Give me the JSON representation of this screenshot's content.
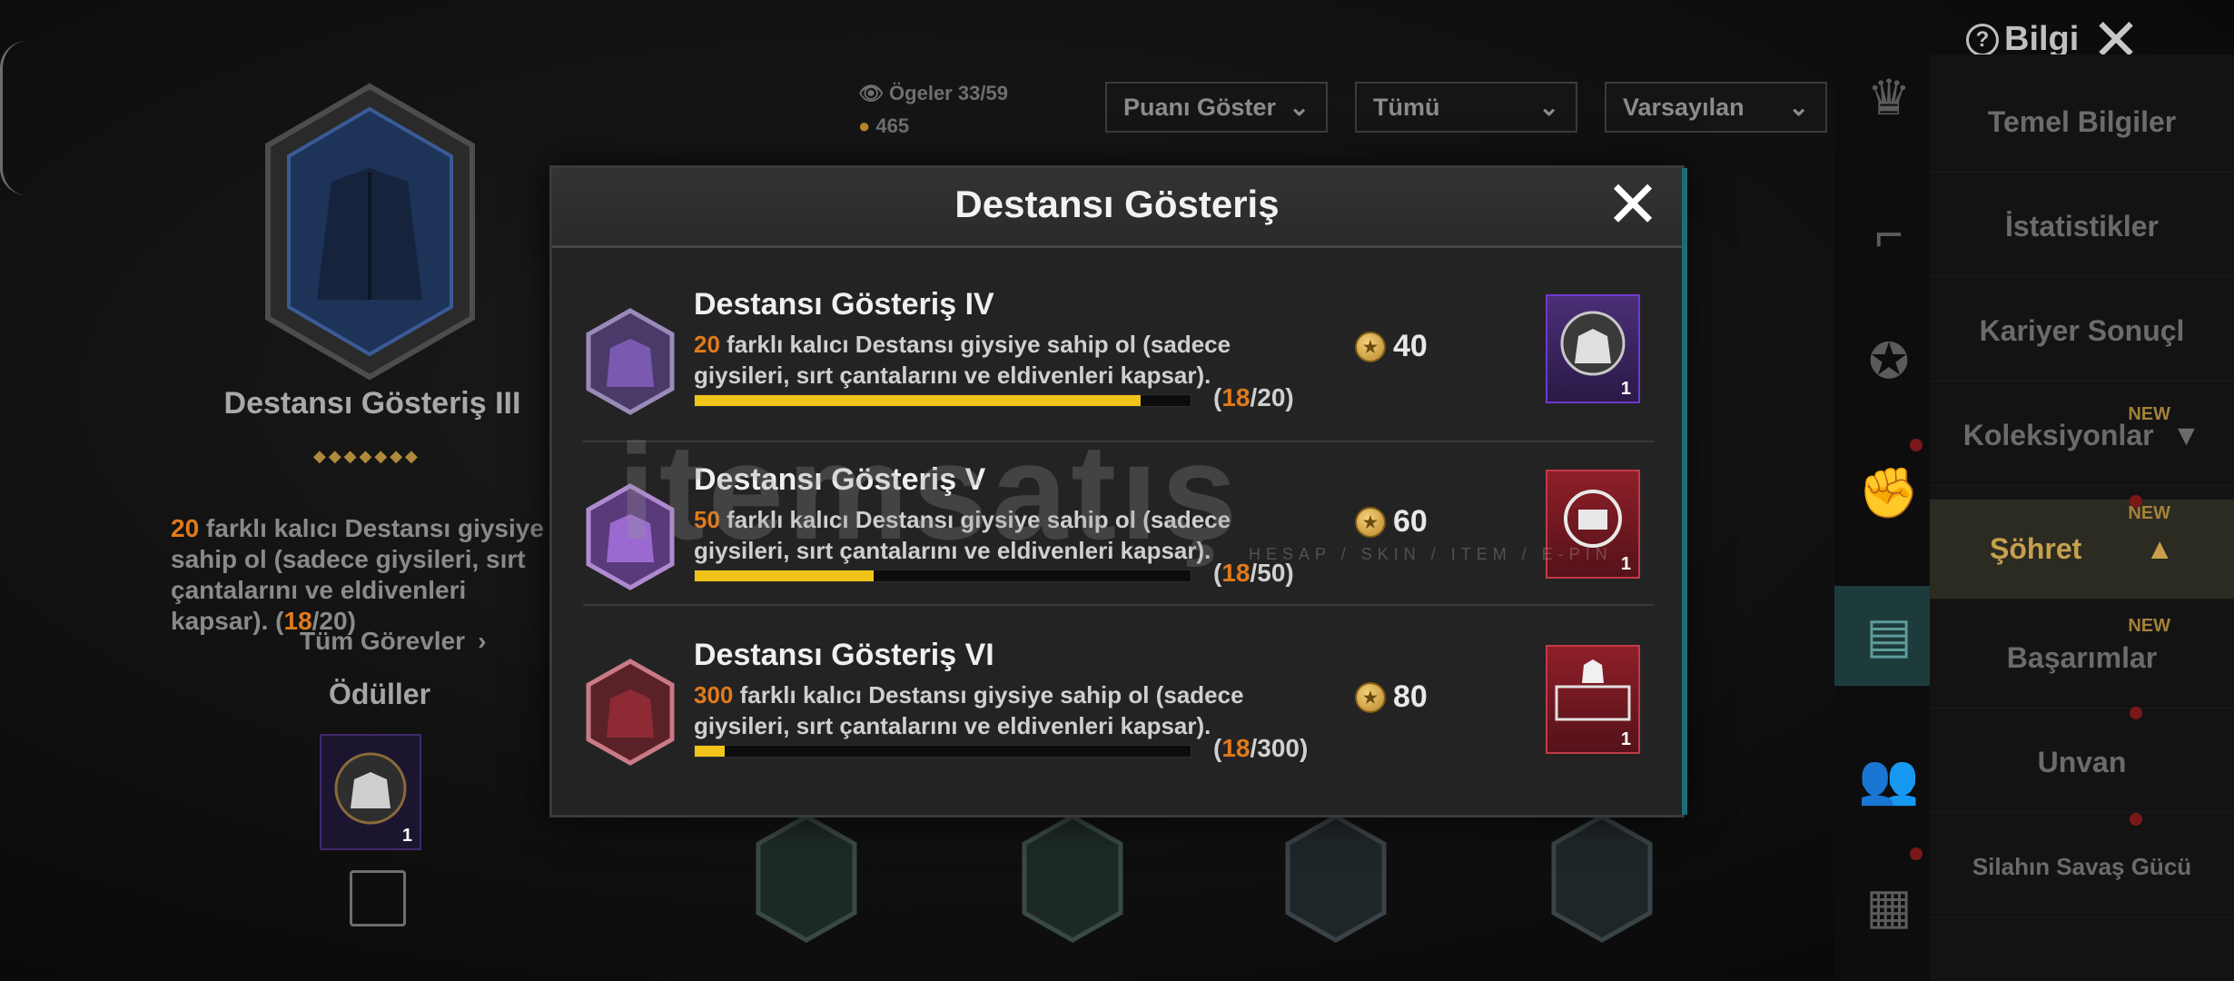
{
  "header": {
    "info_label": "Bilgi",
    "info_icon": "?",
    "close_icon": "✕"
  },
  "filters": {
    "items_label": "Ögeler",
    "items_count": "33/59",
    "points_value": "465",
    "show_points": "Puanı Göster",
    "category": "Tümü",
    "sort": "Varsayılan"
  },
  "left_panel": {
    "title": "Destansı Gösteriş III",
    "dots": "◆◆◆◆◆◆◆",
    "desc_count": "20",
    "desc_text": " farklı kalıcı Destansı giysiye sahip ol (sadece giysileri, sırt çantalarını ve eldivenleri kapsar). (",
    "desc_progress": "18",
    "desc_total": "/20)",
    "all_tasks": "Tüm Görevler",
    "rewards_label": "Ödüller",
    "reward_qty": "1"
  },
  "sidebar": {
    "items": [
      {
        "label": "Temel Bilgiler",
        "new": "",
        "active": false
      },
      {
        "label": "İstatistikler",
        "new": "",
        "active": false
      },
      {
        "label": "Kariyer Sonuçl",
        "new": "",
        "active": false
      },
      {
        "label": "Koleksiyonlar",
        "new": "NEW",
        "active": false
      },
      {
        "label": "Şöhret",
        "new": "NEW",
        "active": true
      },
      {
        "label": "Başarımlar",
        "new": "NEW",
        "active": false
      },
      {
        "label": "Unvan",
        "new": "",
        "active": false
      },
      {
        "label": "Silahın Savaş Gücü",
        "new": "",
        "active": false
      }
    ]
  },
  "modal": {
    "title": "Destansı Gösteriş",
    "close_icon": "✕",
    "rows": [
      {
        "title": "Destansı Gösteriş IV",
        "count": "20",
        "text": " farklı kalıcı Destansı giysiye sahip ol (sadece giysileri, sırt çantalarını ve eldivenleri kapsar).",
        "progress": "18",
        "total": "/20)",
        "open": "(",
        "points": "40",
        "reward_qty": "1",
        "fill": 0.9
      },
      {
        "title": "Destansı Gösteriş V",
        "count": "50",
        "text": " farklı kalıcı Destansı giysiye sahip ol (sadece giysileri, sırt çantalarını ve eldivenleri kapsar).",
        "progress": "18",
        "total": "/50)",
        "open": "(",
        "points": "60",
        "reward_qty": "1",
        "fill": 0.36
      },
      {
        "title": "Destansı Gösteriş VI",
        "count": "300",
        "text": " farklı kalıcı Destansı giysiye sahip ol (sadece giysileri, sırt çantalarını ve eldivenleri kapsar).",
        "progress": "18",
        "total": "/300)",
        "open": "(",
        "points": "80",
        "reward_qty": "1",
        "fill": 0.06
      }
    ]
  },
  "watermark": {
    "main": "itemsatış",
    "sub": "HESAP / SKIN / ITEM / E-PIN"
  },
  "colors": {
    "accent_orange": "#e07a1a",
    "progress_yellow": "#f0c419",
    "active_gold": "#c7a04c"
  }
}
